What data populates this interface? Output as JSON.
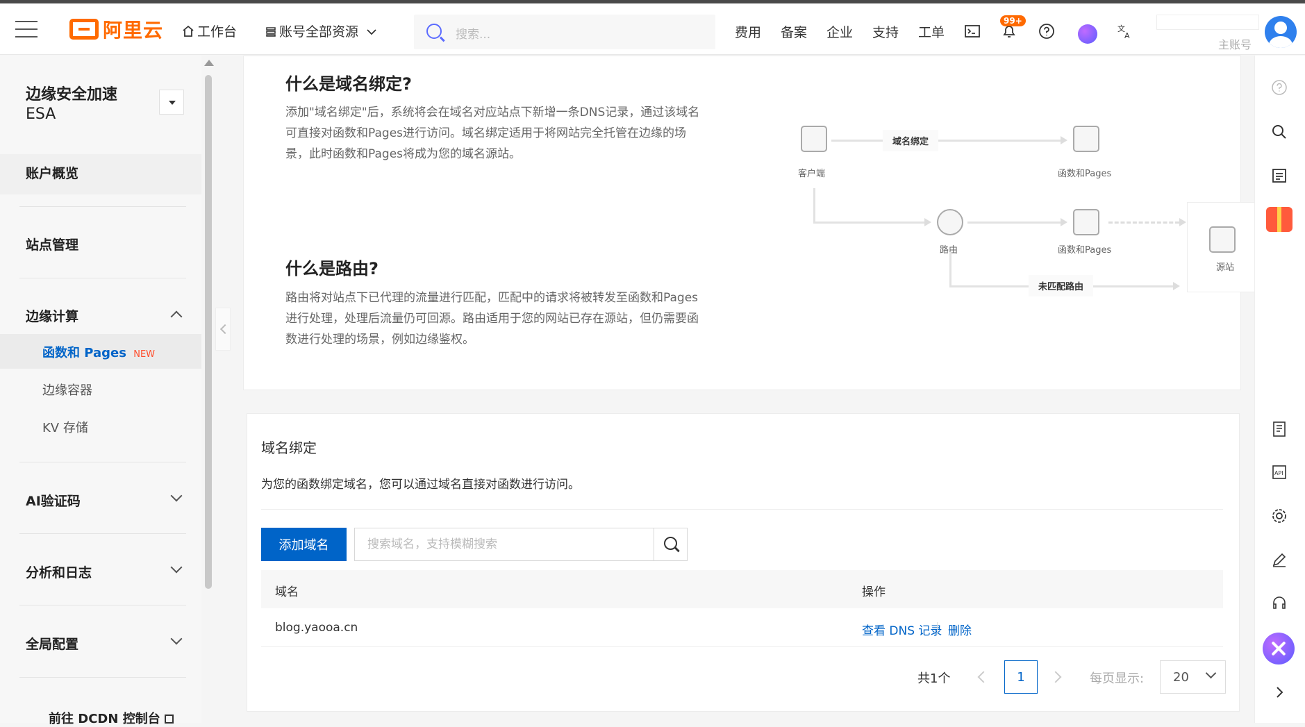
{
  "topbar": {
    "logo_text": "阿里云",
    "workbench": "工作台",
    "resources": "账号全部资源",
    "search_placeholder": "搜索...",
    "nav": [
      "费用",
      "备案",
      "企业",
      "支持",
      "工单"
    ],
    "notification_badge": "99+",
    "account_role": "主账号"
  },
  "sidebar": {
    "product_name": "边缘安全加速",
    "product_code": "ESA",
    "items": {
      "overview": "账户概览",
      "sites": "站点管理",
      "edge_compute": "边缘计算",
      "functions_pages": "函数和 Pages",
      "new_badge": "NEW",
      "edge_container": "边缘容器",
      "kv_storage": "KV 存储",
      "ai_captcha": "AI验证码",
      "analytics_logs": "分析和日志",
      "global_config": "全局配置",
      "goto_dcdn": "前往 DCDN 控制台"
    }
  },
  "intro": {
    "binding_title": "什么是域名绑定?",
    "binding_desc": "添加\"域名绑定\"后，系统将会在域名对应站点下新增一条DNS记录，通过该域名可直接对函数和Pages进行访问。域名绑定适用于将网站完全托管在边缘的场景，此时函数和Pages将成为您的域名源站。",
    "route_title": "什么是路由?",
    "route_desc": "路由将对站点下已代理的流量进行匹配，匹配中的请求将被转发至函数和Pages进行处理，处理后流量仍可回源。路由适用于您的网站已存在源站，但仍需要函数进行处理的场景，例如边缘鉴权。",
    "diagram": {
      "client": "客户端",
      "domain_binding": "域名绑定",
      "functions_pages_1": "函数和Pages",
      "route": "路由",
      "functions_pages_2": "函数和Pages",
      "origin": "源站",
      "unmatched_route": "未匹配路由"
    }
  },
  "domain_binding": {
    "title": "域名绑定",
    "description": "为您的函数绑定域名，您可以通过域名直接对函数进行访问。",
    "add_button": "添加域名",
    "search_placeholder": "搜索域名，支持模糊搜索",
    "columns": {
      "domain": "域名",
      "actions": "操作"
    },
    "rows": [
      {
        "domain": "blog.yaooa.cn",
        "view_dns": "查看 DNS 记录",
        "delete": "删除"
      }
    ],
    "pagination": {
      "total": "共1个",
      "current_page": "1",
      "page_size_label": "每页显示:",
      "page_size": "20"
    }
  }
}
